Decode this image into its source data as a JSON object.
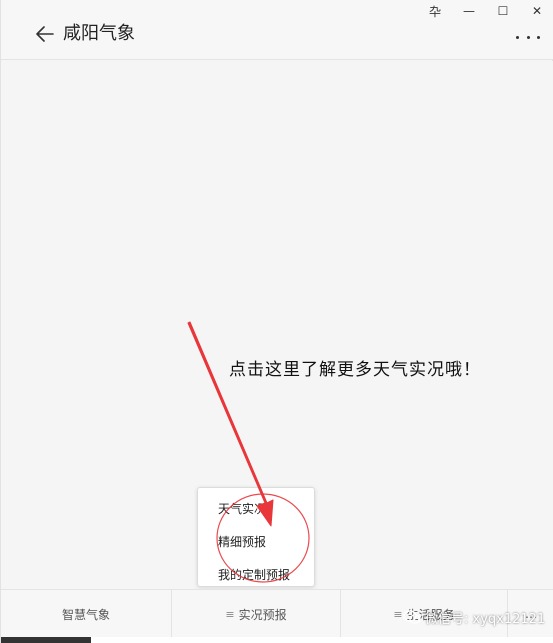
{
  "window": {
    "controls": {
      "pin_glyph": "卆",
      "minimize_glyph": "—",
      "maximize_glyph": "☐",
      "close_glyph": "✕"
    }
  },
  "header": {
    "title": "咸阳气象"
  },
  "content": {
    "hint": "点击这里了解更多天气实况哦！"
  },
  "popup_menu": {
    "items": [
      {
        "label": "天气实况"
      },
      {
        "label": "精细预报"
      },
      {
        "label": "我的定制预报"
      }
    ]
  },
  "bottom_nav": {
    "items": [
      {
        "label": "智慧气象"
      },
      {
        "menu_glyph": "≡",
        "label": "实况预报"
      },
      {
        "menu_glyph": "≡",
        "label": "生活服务"
      },
      {
        "label": "…"
      }
    ]
  },
  "watermark": {
    "text": "微信号: xyqx12121"
  },
  "colors": {
    "annotation_red": "#e8363a",
    "background": "#f5f5f5"
  }
}
